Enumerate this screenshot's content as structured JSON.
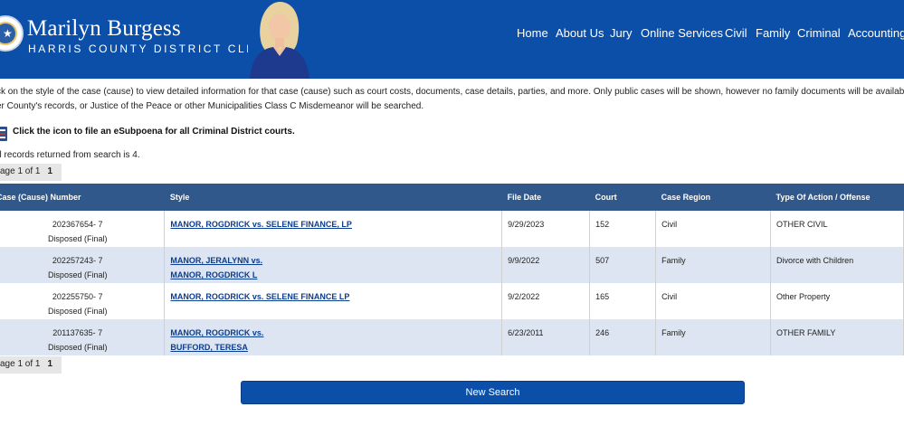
{
  "header": {
    "name": "Marilyn Burgess",
    "subtitle": "HARRIS COUNTY DISTRICT CLERK",
    "nav": [
      "Home",
      "About Us",
      "Jury",
      "Online Services",
      "Civil",
      "Family",
      "Criminal",
      "Accounting"
    ]
  },
  "intro": {
    "line1": "ck on the style of the case (cause) to view detailed information for that case (cause) such as court costs, documents, case details, parties, and more. Only public cases will be shown, however no family documents will be available for",
    "line2": "er County's records, or Justice of the Peace or other Municipalities Class C Misdemeanor will be searched."
  },
  "subpoena": {
    "text": "Click the icon to file an eSubpoena for all Criminal District courts.",
    "icon": "document-icon"
  },
  "total_text": "al records returned from search is 4.",
  "pager": {
    "label": "age 1 of 1",
    "current": "1"
  },
  "table": {
    "headers": [
      "Case (Cause) Number",
      "Style",
      "File Date",
      "Court",
      "Case Region",
      "Type Of Action / Offense"
    ],
    "rows": [
      {
        "case_number": "202367654- 7",
        "status": "Disposed (Final)",
        "style1": "MANOR, ROGDRICK vs. SELENE FINANCE, LP",
        "style2": "",
        "file_date": "9/29/2023",
        "court": "152",
        "region": "Civil",
        "action": "OTHER CIVIL"
      },
      {
        "case_number": "202257243- 7",
        "status": "Disposed (Final)",
        "style1": "MANOR, JERALYNN vs.",
        "style2": "MANOR, ROGDRICK L",
        "file_date": "9/9/2022",
        "court": "507",
        "region": "Family",
        "action": "Divorce with Children"
      },
      {
        "case_number": "202255750- 7",
        "status": "Disposed (Final)",
        "style1": "MANOR, ROGDRICK vs. SELENE FINANCE LP",
        "style2": "",
        "file_date": "9/2/2022",
        "court": "165",
        "region": "Civil",
        "action": "Other Property"
      },
      {
        "case_number": "201137635- 7",
        "status": "Disposed (Final)",
        "style1": "MANOR, ROGDRICK vs.",
        "style2": "BUFFORD, TERESA",
        "file_date": "6/23/2011",
        "court": "246",
        "region": "Family",
        "action": "OTHER FAMILY"
      }
    ]
  },
  "button": {
    "new_search": "New Search"
  },
  "colors": {
    "header_bg": "#0b4fa8",
    "table_header_bg": "#31588a",
    "alt_row_bg": "#dce5f1",
    "link": "#0b3d91"
  }
}
